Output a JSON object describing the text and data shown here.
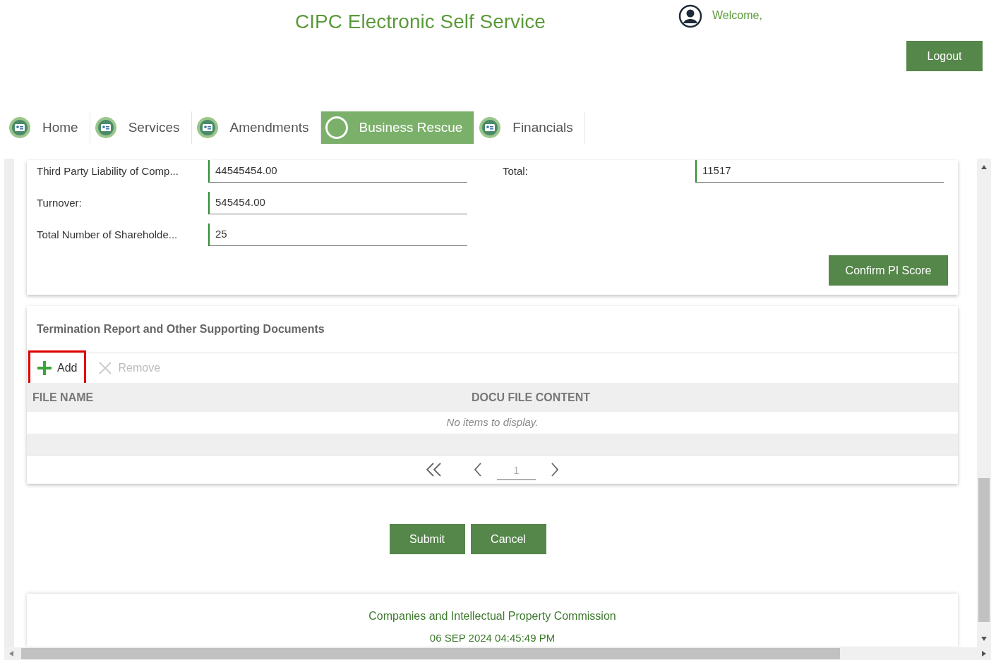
{
  "header": {
    "title": "CIPC Electronic Self Service",
    "welcome": "Welcome,",
    "logout": "Logout"
  },
  "nav": [
    {
      "label": "Home",
      "selected": false
    },
    {
      "label": "Services",
      "selected": false
    },
    {
      "label": "Amendments",
      "selected": false
    },
    {
      "label": "Business Rescue",
      "selected": true
    },
    {
      "label": "Financials",
      "selected": false
    }
  ],
  "pi_panel": {
    "fields": [
      {
        "label": "Third Party Liability of Comp...",
        "value": "44545454.00",
        "right_label": "Total:",
        "right_value": "11517"
      },
      {
        "label": "Turnover:",
        "value": "545454.00"
      },
      {
        "label": "Total Number of Shareholde...",
        "value": "25"
      }
    ],
    "confirm": "Confirm PI Score"
  },
  "documents": {
    "title": "Termination Report and Other Supporting Documents",
    "toolbar": [
      {
        "label": "Add",
        "kind": "add",
        "disabled": false,
        "highlighted": true
      },
      {
        "label": "Remove",
        "kind": "remove",
        "disabled": true,
        "highlighted": false
      }
    ],
    "columns": [
      "FILE NAME",
      "DOCU FILE CONTENT"
    ],
    "empty": "No items to display.",
    "pager": {
      "page": "1"
    }
  },
  "actions": [
    "Submit",
    "Cancel"
  ],
  "footer": {
    "org": "Companies and Intellectual Property Commission",
    "date": "06 SEP 2024 04:45:49 PM"
  }
}
